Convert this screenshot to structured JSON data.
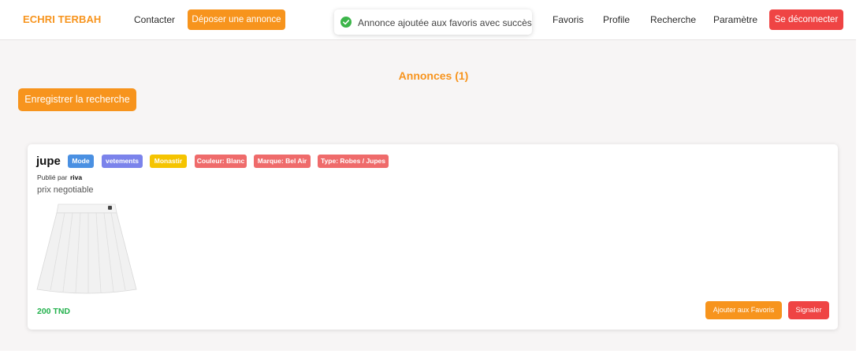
{
  "navbar": {
    "brand": "ECHRI TERBAH",
    "contact_label": "Contacter",
    "post_ad_label": "Déposer une annonce",
    "favorites_label": "Favoris",
    "profile_label": "Profile",
    "search_label": "Recherche",
    "settings_label": "Paramètre",
    "logout_label": "Se déconnecter"
  },
  "toast": {
    "icon": "check-circle-icon",
    "message": "Annonce ajoutée aux favoris avec succès"
  },
  "main": {
    "title": "Annonces (1)",
    "save_search_label": "Enregistrer la recherche"
  },
  "listing": {
    "title": "jupe",
    "tags": [
      {
        "label": "Mode",
        "color": "#4a90e2"
      },
      {
        "label": "vetements",
        "color": "#7b83eb"
      },
      {
        "label": "Monastir",
        "color": "#f5c400"
      },
      {
        "label": "Couleur: Blanc",
        "color": "#ef6b6b"
      },
      {
        "label": "Marque: Bel Air",
        "color": "#ef6b6b"
      },
      {
        "label": "Type: Robes / Jupes",
        "color": "#ef6b6b"
      }
    ],
    "published_by_label": "Publié par",
    "author": "riva",
    "description": "prix negotiable",
    "image": "white-pleated-skirt",
    "price": "200 TND",
    "add_favorite_label": "Ajouter aux Favoris",
    "report_label": "Signaler"
  },
  "colors": {
    "accent": "#f7941d",
    "danger": "#ef4444",
    "price": "#22b14c",
    "success": "#3cb54a"
  }
}
